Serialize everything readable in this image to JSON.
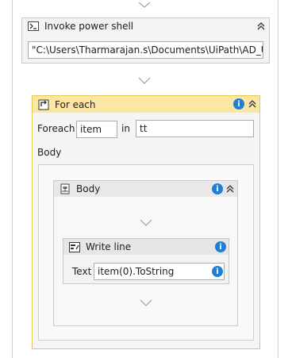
{
  "invoke": {
    "title": "Invoke power shell",
    "command": "\"C:\\Users\\Tharmarajan.s\\Documents\\UiPath\\AD_User_"
  },
  "foreach": {
    "title": "For each",
    "foreach_label": "Foreach",
    "item_value": "item",
    "in_label": "in",
    "collection_value": "tt",
    "body_label": "Body"
  },
  "body": {
    "title": "Body"
  },
  "writeline": {
    "title": "Write line",
    "text_label": "Text",
    "text_value": "item(0).ToString"
  },
  "icons": {
    "warning": "i",
    "collapse": "chevrons-up-icon",
    "arrow": "down-triangle-icon"
  }
}
